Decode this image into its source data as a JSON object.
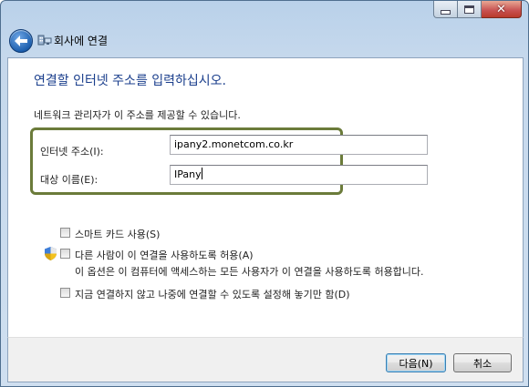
{
  "window": {
    "title": "회사에 연결",
    "caption_buttons": [
      "minimize",
      "maximize",
      "close"
    ]
  },
  "header": {
    "back_button_label": "Back",
    "instruction": "연결할 인터넷 주소를 입력하십시오.",
    "admin_note": "네트워크 관리자가 이 주소를 제공할 수 있습니다."
  },
  "form": {
    "internet_address": {
      "label": "인터넷 주소(I):",
      "value": "ipany2.monetcom.co.kr"
    },
    "destination_name": {
      "label": "대상 이름(E):",
      "value": "IPany"
    }
  },
  "options": {
    "smart_card": {
      "label": "스마트 카드 사용(S)",
      "checked": false
    },
    "allow_others": {
      "label": "다른 사람이 이 연결을 사용하도록 허용(A)",
      "description": "이 옵션은 이 컴퓨터에 액세스하는 모든 사용자가 이 연결을 사용하도록 허용합니다.",
      "checked": false
    },
    "dont_connect_now": {
      "label": "지금 연결하지 않고 나중에 연결할 수 있도록 설정해 놓기만 함(D)",
      "checked": false
    }
  },
  "footer": {
    "next_label": "다음(N)",
    "cancel_label": "취소"
  },
  "colors": {
    "instruction_text": "#1a3e8c",
    "highlight_border": "#6b7b3a",
    "frame": "#b9d1ea"
  }
}
